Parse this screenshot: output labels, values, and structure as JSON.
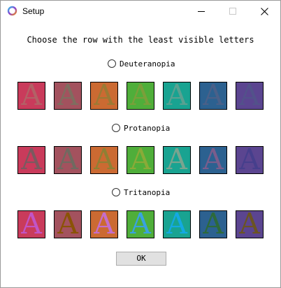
{
  "window": {
    "title": "Setup"
  },
  "prompt": "Choose the row with the least visible letters",
  "options": [
    {
      "label": "Deuteranopia",
      "selected": false
    },
    {
      "label": "Protanopia",
      "selected": false
    },
    {
      "label": "Tritanopia",
      "selected": false
    }
  ],
  "tile_letter": "A",
  "rows": [
    {
      "tiles": [
        {
          "bg": "#c93b5b",
          "fg": "#b26266"
        },
        {
          "bg": "#a3525e",
          "fg": "#7e6e5f"
        },
        {
          "bg": "#cb6a32",
          "fg": "#9b7a34"
        },
        {
          "bg": "#4fae3a",
          "fg": "#7b9f3a"
        },
        {
          "bg": "#19a391",
          "fg": "#5aa191"
        },
        {
          "bg": "#2c6190",
          "fg": "#4a6088"
        },
        {
          "bg": "#5b4590",
          "fg": "#52528a"
        }
      ]
    },
    {
      "tiles": [
        {
          "bg": "#c93b5b",
          "fg": "#7a5a5f"
        },
        {
          "bg": "#a3525e",
          "fg": "#6f6a60"
        },
        {
          "bg": "#cb6a32",
          "fg": "#8e8034"
        },
        {
          "bg": "#4fae3a",
          "fg": "#8aaa38"
        },
        {
          "bg": "#19a391",
          "fg": "#7aa48f"
        },
        {
          "bg": "#2c6190",
          "fg": "#7a5d8c"
        },
        {
          "bg": "#5b4590",
          "fg": "#463f8c"
        }
      ]
    },
    {
      "tiles": [
        {
          "bg": "#c93b5b",
          "fg": "#c154c6"
        },
        {
          "bg": "#a3525e",
          "fg": "#8a5306"
        },
        {
          "bg": "#cb6a32",
          "fg": "#c46ecb"
        },
        {
          "bg": "#4fae3a",
          "fg": "#39a2e0"
        },
        {
          "bg": "#19a391",
          "fg": "#13a9e3"
        },
        {
          "bg": "#2c6190",
          "fg": "#2d6a3a"
        },
        {
          "bg": "#5b4590",
          "fg": "#6b5422"
        }
      ]
    }
  ],
  "ok_label": "OK"
}
